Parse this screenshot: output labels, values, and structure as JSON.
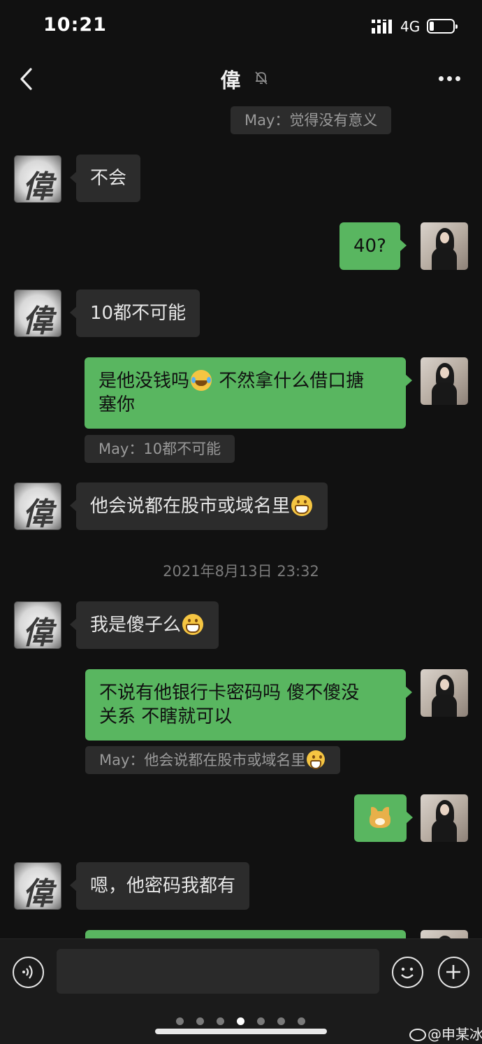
{
  "status_bar": {
    "time": "10:21",
    "network": "4G"
  },
  "header": {
    "title": "偉"
  },
  "messages": [
    {
      "type": "quote",
      "text": "May：觉得没有意义"
    },
    {
      "type": "incoming",
      "sender_avatar": "偉",
      "text": "不会"
    },
    {
      "type": "outgoing",
      "text": "40?"
    },
    {
      "type": "incoming",
      "sender_avatar": "偉",
      "text": "10都不可能"
    },
    {
      "type": "outgoing",
      "text_a": "是他没钱吗",
      "emoji": "face-with-tears-of-joy",
      "text_b": " 不然拿什么借口搪",
      "text_c": "塞你"
    },
    {
      "type": "quote",
      "text": "May：10都不可能"
    },
    {
      "type": "incoming",
      "sender_avatar": "偉",
      "text": "他会说都在股市或域名里",
      "emoji": "grinning-face"
    },
    {
      "type": "timestamp",
      "text": "2021年8月13日 23:32"
    },
    {
      "type": "incoming",
      "sender_avatar": "偉",
      "text": "我是傻子么",
      "emoji": "grinning-face"
    },
    {
      "type": "outgoing",
      "text_a": "不说有他银行卡密码吗  傻不傻没",
      "text_b": "关系 不瞎就可以"
    },
    {
      "type": "quote",
      "text": "May：他会说都在股市或域名里",
      "emoji": "grinning-face"
    },
    {
      "type": "outgoing",
      "sticker": "doge"
    },
    {
      "type": "incoming",
      "sender_avatar": "偉",
      "text": "嗯，他密码我都有"
    }
  ],
  "input_bar": {
    "text_value": "",
    "page_count": 7,
    "active_page": 4
  },
  "watermark": {
    "text": "@申某冰"
  },
  "colors": {
    "background": "#111111",
    "outgoing_bubble": "#59b660",
    "incoming_bubble": "#2c2c2c"
  }
}
